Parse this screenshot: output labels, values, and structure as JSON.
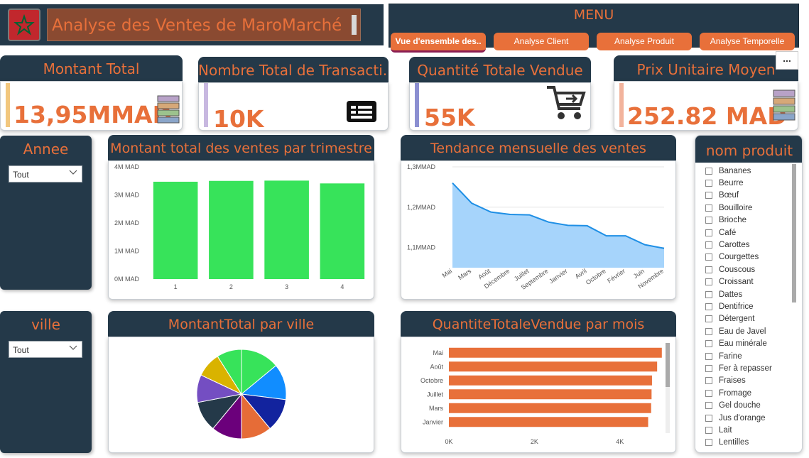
{
  "header": {
    "title": "Analyse des Ventes de MaroMarché",
    "menu_label": "MENU",
    "menu_buttons": [
      "Vue d'ensemble des..",
      "Analyse Client",
      "Analyse Produit",
      "Analyse Temporelle"
    ],
    "colors": {
      "navy": "#243949",
      "accent": "#e8703a",
      "flag_red": "#c1272d",
      "flag_green": "#006233"
    }
  },
  "kpis": [
    {
      "title": "Montant Total",
      "value": "13,95MMAD",
      "icon": "banknotes-icon",
      "accent": "#f2c77e"
    },
    {
      "title": "Nombre Total de Transacti...",
      "value": "10K",
      "icon": "receipt-icon",
      "accent": "#c8b8e0"
    },
    {
      "title": "Quantité Totale Vendue",
      "value": "55K",
      "icon": "shopping-cart-icon",
      "accent": "#8b8fd1"
    },
    {
      "title": "Prix Unitaire Moyen",
      "value": "252.82 MAD",
      "icon": "banknotes-icon",
      "accent": "#f2b39c"
    }
  ],
  "more_options": "...",
  "slicers": {
    "annee": {
      "title": "Annee",
      "value": "Tout"
    },
    "ville": {
      "title": "ville",
      "value": "Tout"
    }
  },
  "products": {
    "title": "nom produit",
    "items": [
      "Bananes",
      "Beurre",
      "Bœuf",
      "Bouilloire",
      "Brioche",
      "Café",
      "Carottes",
      "Courgettes",
      "Couscous",
      "Croissant",
      "Dattes",
      "Dentifrice",
      "Détergent",
      "Eau de Javel",
      "Eau minérale",
      "Farine",
      "Fer à repasser",
      "Fraises",
      "Fromage",
      "Gel douche",
      "Jus d'orange",
      "Lait",
      "Lentilles"
    ]
  },
  "charts": {
    "quarter_title": "Montant total des ventes par trimestre",
    "monthly_title": "Tendance mensuelle des ventes",
    "city_title": "MontantTotal par ville",
    "qty_title": "QuantiteTotaleVendue par mois"
  },
  "chart_data": [
    {
      "type": "bar",
      "title": "Montant total des ventes par trimestre",
      "categories": [
        "1",
        "2",
        "3",
        "4"
      ],
      "values": [
        3.47,
        3.5,
        3.51,
        3.41
      ],
      "y_unit": "M MAD",
      "y_ticks": [
        "0M MAD",
        "1M MAD",
        "2M MAD",
        "3M MAD",
        "4M MAD"
      ],
      "ylim": [
        0,
        4
      ],
      "color": "#37e35a"
    },
    {
      "type": "area",
      "title": "Tendance mensuelle des ventes",
      "categories": [
        "Mai",
        "Mars",
        "Août",
        "Décembre",
        "Juillet",
        "Septembre",
        "Janvier",
        "Avril",
        "Octobre",
        "Février",
        "Juin",
        "Novembre"
      ],
      "values": [
        1.26,
        1.21,
        1.188,
        1.182,
        1.181,
        1.163,
        1.155,
        1.154,
        1.129,
        1.129,
        1.107,
        1.098
      ],
      "y_ticks": [
        "1,1MMAD",
        "1,2MMAD",
        "1,3MMAD"
      ],
      "ylim": [
        1.05,
        1.3
      ],
      "color": "#1f8fe5",
      "fill": "#a6d4fb"
    },
    {
      "type": "pie",
      "title": "MontantTotal par ville",
      "values": [
        14,
        13,
        12,
        11,
        11,
        11,
        10,
        9,
        9
      ],
      "colors": [
        "#37e35a",
        "#118dff",
        "#12239e",
        "#e66c37",
        "#6b007b",
        "#243949",
        "#744ec2",
        "#d9b300",
        "#37e35a"
      ]
    },
    {
      "type": "bar",
      "orientation": "horizontal",
      "title": "QuantiteTotaleVendue par mois",
      "categories": [
        "Mai",
        "Août",
        "Octobre",
        "Juillet",
        "Mars",
        "Janvier"
      ],
      "values": [
        4980,
        4870,
        4750,
        4740,
        4730,
        4660
      ],
      "x_ticks": [
        "0K",
        "2K",
        "4K"
      ],
      "xlim": [
        0,
        5000
      ],
      "color": "#e8703a"
    }
  ]
}
